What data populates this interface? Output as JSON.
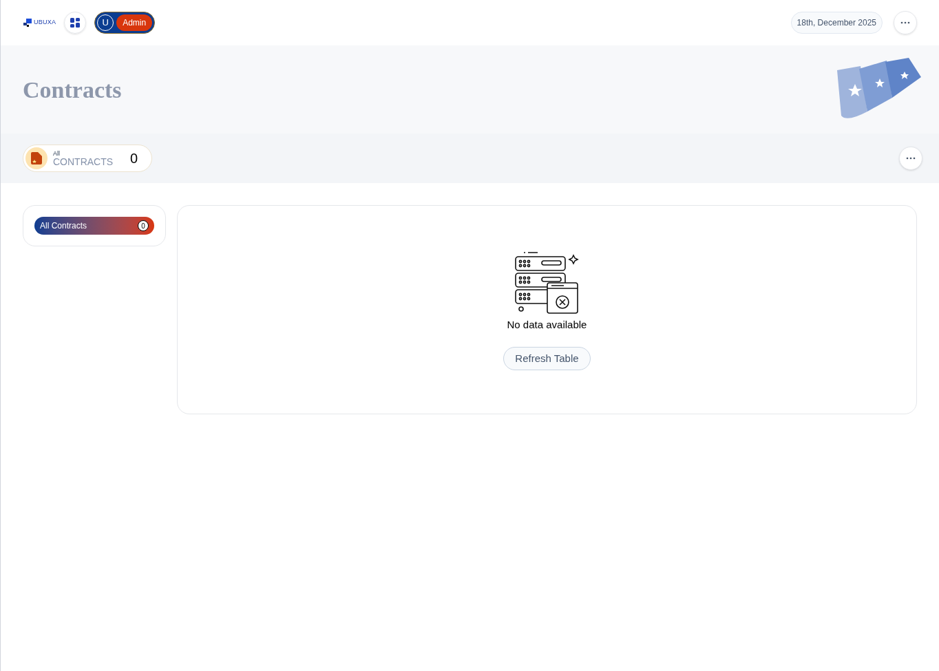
{
  "header": {
    "logo_text": "UBUXA",
    "user_initial": "U",
    "role": "Admin",
    "date": "18th, December 2025"
  },
  "page": {
    "title": "Contracts"
  },
  "stat": {
    "label_small": "All",
    "label": "CONTRACTS",
    "count": "0"
  },
  "sidebar": {
    "items": [
      {
        "label": "All Contracts",
        "count": "0",
        "selected": true
      }
    ]
  },
  "empty_state": {
    "message": "No data available",
    "button": "Refresh Table"
  }
}
